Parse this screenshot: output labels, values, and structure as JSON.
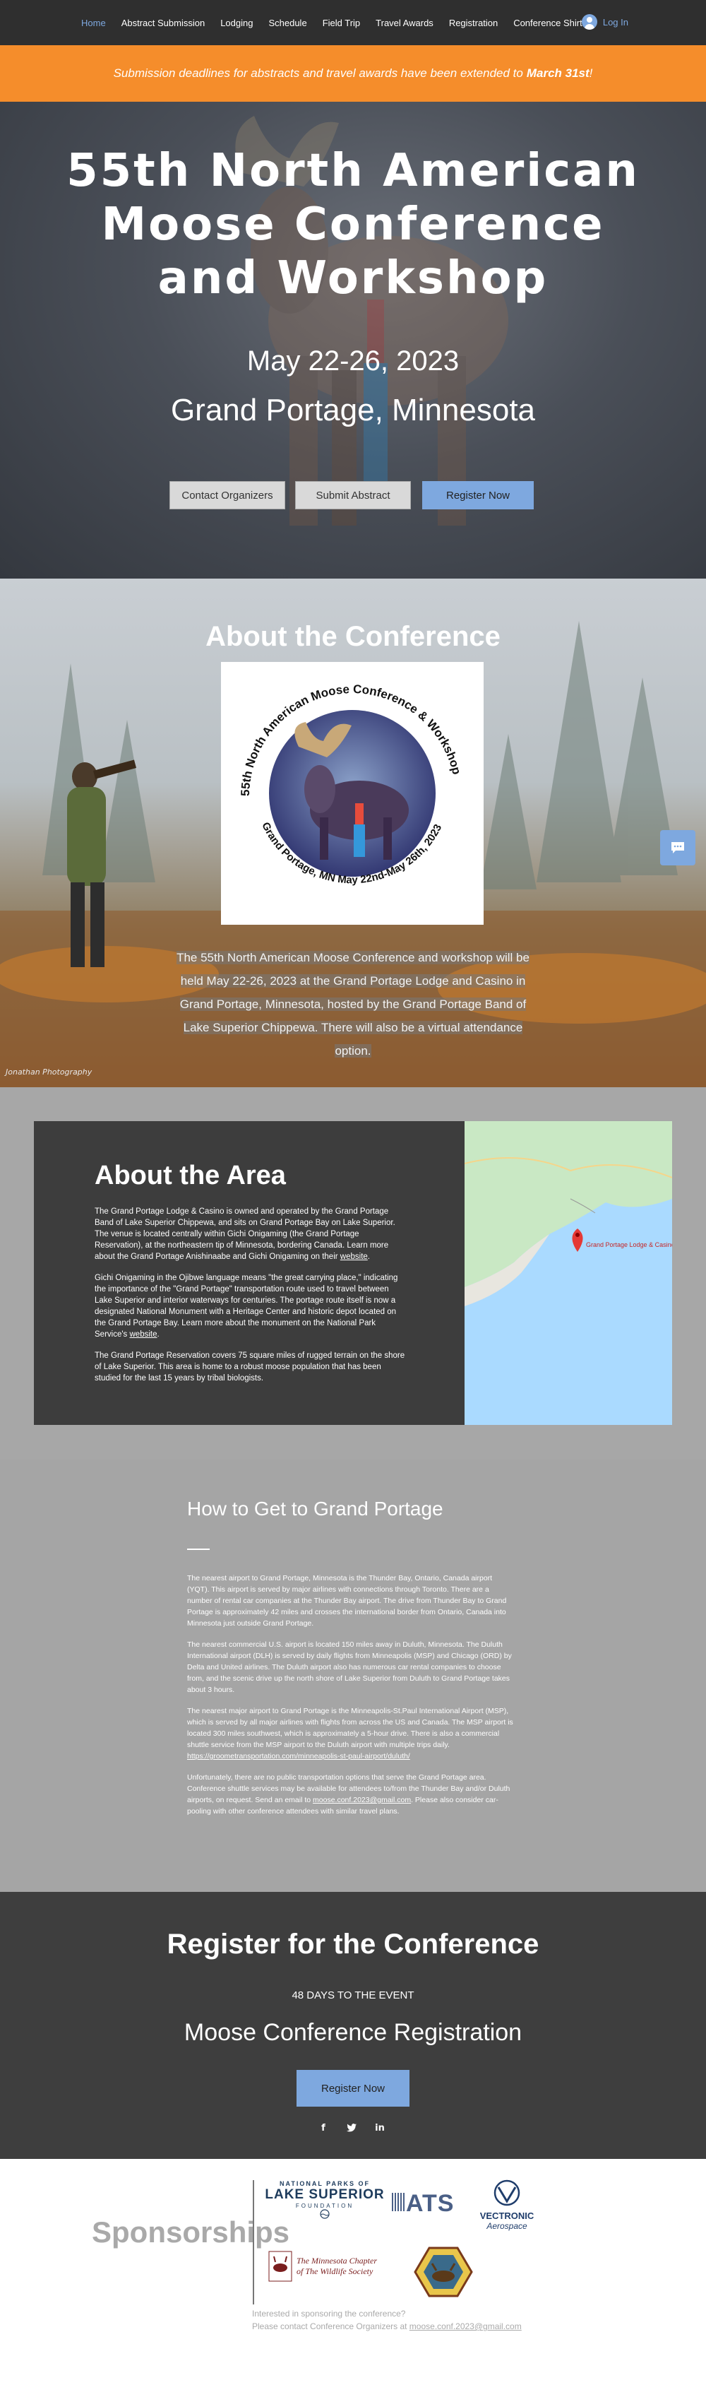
{
  "nav": {
    "items": [
      "Home",
      "Abstract Submission",
      "Lodging",
      "Schedule",
      "Field Trip",
      "Travel Awards",
      "Registration",
      "Conference Shirts"
    ],
    "login": "Log In"
  },
  "banner": {
    "text": "Submission deadlines for abstracts and travel awards have been extended to",
    "bold": "March 31st",
    "end": "!"
  },
  "hero": {
    "title_line1": "55th North American",
    "title_line2": "Moose Conference",
    "title_line3": "and Workshop",
    "dates": "May 22-26, 2023",
    "place": "Grand Portage, Minnesota",
    "buttons": {
      "contact": "Contact Organizers",
      "submit": "Submit Abstract",
      "register": "Register Now"
    }
  },
  "about_conference": {
    "title": "About the Conference",
    "logo_text_top": "55th North American Moose Conference & Workshop",
    "logo_text_bottom": "Grand Portage, MN May 22nd-May 26th, 2023",
    "body": "The 55th North American Moose Conference and workshop will be held May 22-26, 2023 at the Grand Portage Lodge and Casino in Grand Portage, Minnesota, hosted by the Grand Portage Band of Lake Superior Chippewa. There will also be a virtual attendance option.",
    "photo_credit": "Jonathan Photography",
    "chat_icon": "chat-icon"
  },
  "about_area": {
    "title": "About the Area",
    "p1": "The Grand Portage Lodge & Casino is owned and operated by the Grand Portage Band of Lake Superior Chippewa, and sits on Grand Portage Bay on Lake Superior. The venue is located centrally within Gichi Onigaming (the Grand Portage Reservation), at the northeastern tip of Minnesota, bordering Canada. Learn more about the Grand Portage Anishinaabe and Gichi Onigaming on their",
    "p1_link": "website",
    "p2": "Gichi Onigaming in the Ojibwe language means \"the great carrying place,\" indicating the importance of the \"Grand Portage\" transportation route used to travel between Lake Superior and interior waterways for centuries. The portage route itself is now a designated National Monument with a Heritage Center and historic depot located on the Grand Portage Bay. Learn more about the monument on the National Park Service's",
    "p2_link": "website",
    "p3": "The Grand Portage Reservation covers 75 square miles of rugged terrain on the shore of Lake Superior. This area is home to a robust moose population that has been studied for the last 15 years by tribal biologists.",
    "map_pin_label": "Grand Portage Lodge & Casino"
  },
  "how_to": {
    "title": "How to Get to Grand Portage",
    "p1": "The nearest airport to Grand Portage, Minnesota is the Thunder Bay, Ontario, Canada airport (YQT). This airport is served by major airlines with connections through Toronto. There are a number of rental car companies at the Thunder Bay airport. The drive from Thunder Bay to Grand Portage is approximately 42 miles and crosses the international border from Ontario, Canada into Minnesota just outside Grand Portage.",
    "p2": "The nearest commercial U.S. airport is located 150 miles away in Duluth, Minnesota. The Duluth International airport (DLH) is served by daily flights from Minneapolis (MSP) and Chicago (ORD) by Delta and United airlines. The Duluth airport also has numerous car rental companies to choose from, and the scenic drive up the north shore of Lake Superior from Duluth to Grand Portage takes about 3 hours.",
    "p3": "The nearest major airport to Grand Portage is the Minneapolis-St.Paul International Airport (MSP), which is served by all major airlines with flights from across the US and Canada. The MSP airport is located 300 miles southwest, which is approximately a 5-hour drive. There is also a commercial shuttle service from the MSP airport to the Duluth airport with multiple trips daily.",
    "p3_link": "https://groometransportation.com/minneapolis-st-paul-airport/duluth/",
    "p4a": "Unfortunately, there are no public transportation options that serve the Grand Portage area. Conference shuttle services may be available for attendees to/from the Thunder Bay and/or Duluth airports, on request. Send an email to",
    "p4_link": "moose.conf.2023@gmail.com",
    "p4b": ". Please also consider car-pooling with other conference attendees with similar travel plans."
  },
  "register": {
    "title": "Register for the Conference",
    "days": "48 DAYS TO THE EVENT",
    "subtitle": "Moose Conference Registration",
    "button": "Register Now",
    "socials": [
      "f",
      "t",
      "in"
    ]
  },
  "sponsors": {
    "title": "Sponsorships",
    "logos": {
      "lake_superior_top": "NATIONAL PARKS OF",
      "lake_superior_main": "LAKE SUPERIOR",
      "lake_superior_sub": "FOUNDATION",
      "ats": "ATS",
      "vectronic_1": "VECTRONIC",
      "vectronic_2": "Aerospace",
      "wildlife_1": "The Minnesota Chapter",
      "wildlife_2": "of The Wildlife Society"
    },
    "contact_line1": "Interested in sponsoring the conference?",
    "contact_line2": "Please contact Conference Organizers at",
    "contact_email": "moose.conf.2023@gmail.com"
  },
  "colors": {
    "accent_blue": "#7ea8df",
    "banner_orange": "#f58d2b",
    "dark": "#3e3e3e"
  }
}
